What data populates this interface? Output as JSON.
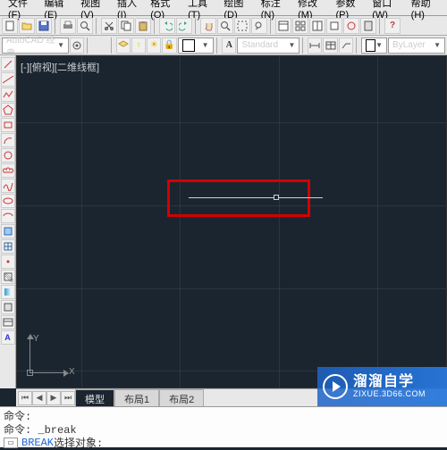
{
  "menu": {
    "file": "文件(F)",
    "edit": "编辑(E)",
    "view": "视图(V)",
    "insert": "插入(I)",
    "format": "格式(O)",
    "tools": "工具(T)",
    "draw": "绘图(D)",
    "dimension": "标注(N)",
    "modify": "修改(M)",
    "param": "参数(P)",
    "window": "窗口(W)",
    "help": "帮助(H)"
  },
  "toolbar2": {
    "workspace_label": "AutoCAD 经典",
    "style_label": "Standard",
    "layer_label": "ByLayer"
  },
  "viewport": {
    "label": "[-][俯视][二维线框]",
    "ucs_x": "X",
    "ucs_y": "Y"
  },
  "tabs": {
    "model": "模型",
    "layout1": "布局1",
    "layout2": "布局2"
  },
  "command": {
    "line1": "命令:",
    "line2": "命令: _break",
    "line3_prefix": "BREAK",
    "line3_rest": " 选择对象:"
  },
  "watermark": {
    "main": "溜溜自学",
    "sub": "ZIXUE.3D66.COM"
  }
}
